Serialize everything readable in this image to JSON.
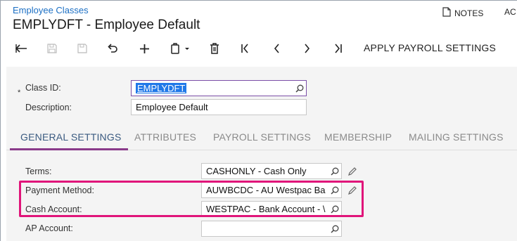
{
  "header": {
    "breadcrumb": "Employee Classes",
    "title": "EMPLYDFT - Employee Default",
    "notes_label": "NOTES",
    "activities_label": "AC"
  },
  "toolbar": {
    "buttons": [
      "back-icon",
      "save-icon",
      "save-close-icon",
      "undo-icon",
      "add-icon",
      "copy-paste-icon",
      "delete-icon",
      "first-icon",
      "previous-icon",
      "next-icon",
      "last-icon"
    ],
    "apply_label": "APPLY PAYROLL SETTINGS"
  },
  "summary": {
    "required_mark": "*",
    "class_id_label": "Class ID:",
    "class_id_value": "EMPLYDFT",
    "description_label": "Description:",
    "description_value": "Employee Default"
  },
  "tabs": {
    "general": "GENERAL SETTINGS",
    "attributes": "ATTRIBUTES",
    "payroll": "PAYROLL SETTINGS",
    "membership": "MEMBERSHIP",
    "mailing": "MAILING SETTINGS"
  },
  "general": {
    "terms_label": "Terms:",
    "terms_value": "CASHONLY - Cash Only",
    "payment_method_label": "Payment Method:",
    "payment_method_value": "AUWBCDC - AU Westpac Ba",
    "cash_account_label": "Cash Account:",
    "cash_account_value": "WESTPAC - Bank Account - \\",
    "ap_account_label": "AP Account:",
    "ap_account_value": ""
  },
  "colors": {
    "link": "#1b6fc4",
    "highlight": "#e0157a",
    "active_tab_underline": "#8a3a8a",
    "selection": "#1f78e8"
  }
}
